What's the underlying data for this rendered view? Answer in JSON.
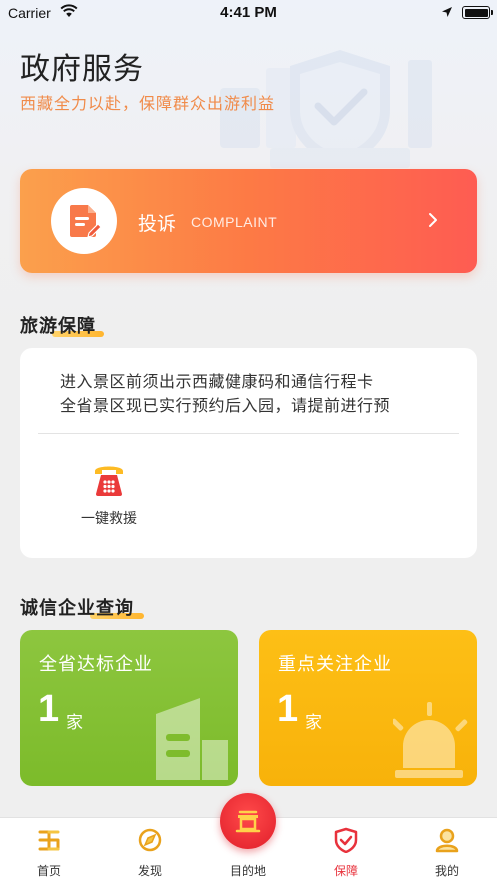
{
  "status_bar": {
    "carrier": "Carrier",
    "time": "4:41 PM"
  },
  "header": {
    "title": "政府服务",
    "subtitle": "西藏全力以赴，保障群众出游利益"
  },
  "complaint": {
    "label": "投诉",
    "sub_label": "COMPLAINT",
    "icon": "document-edit-icon"
  },
  "tourism_guarantee": {
    "section_title": "旅游保障",
    "notices": [
      "进入景区前须出示西藏健康码和通信行程卡",
      "全省景区现已实行预约后入园，请提前进行预"
    ],
    "rescue_label": "一键救援",
    "rescue_icon": "telephone-icon"
  },
  "enterprise": {
    "section_title": "诚信企业查询",
    "cards": [
      {
        "title": "全省达标企业",
        "count": "1",
        "unit": "家",
        "icon": "building-icon",
        "color": "#8dc63f"
      },
      {
        "title": "重点关注企业",
        "count": "1",
        "unit": "家",
        "icon": "alarm-siren-icon",
        "color": "#fdbf16"
      }
    ]
  },
  "tab_bar": {
    "tabs": [
      {
        "label": "首页",
        "icon": "home-swirl-icon"
      },
      {
        "label": "发现",
        "icon": "discover-compass-icon"
      },
      {
        "label": "目的地",
        "icon": "destination-gate-icon"
      },
      {
        "label": "保障",
        "icon": "shield-check-icon"
      },
      {
        "label": "我的",
        "icon": "user-profile-icon"
      }
    ],
    "active": "保障",
    "accent_color": "#e8323c"
  }
}
